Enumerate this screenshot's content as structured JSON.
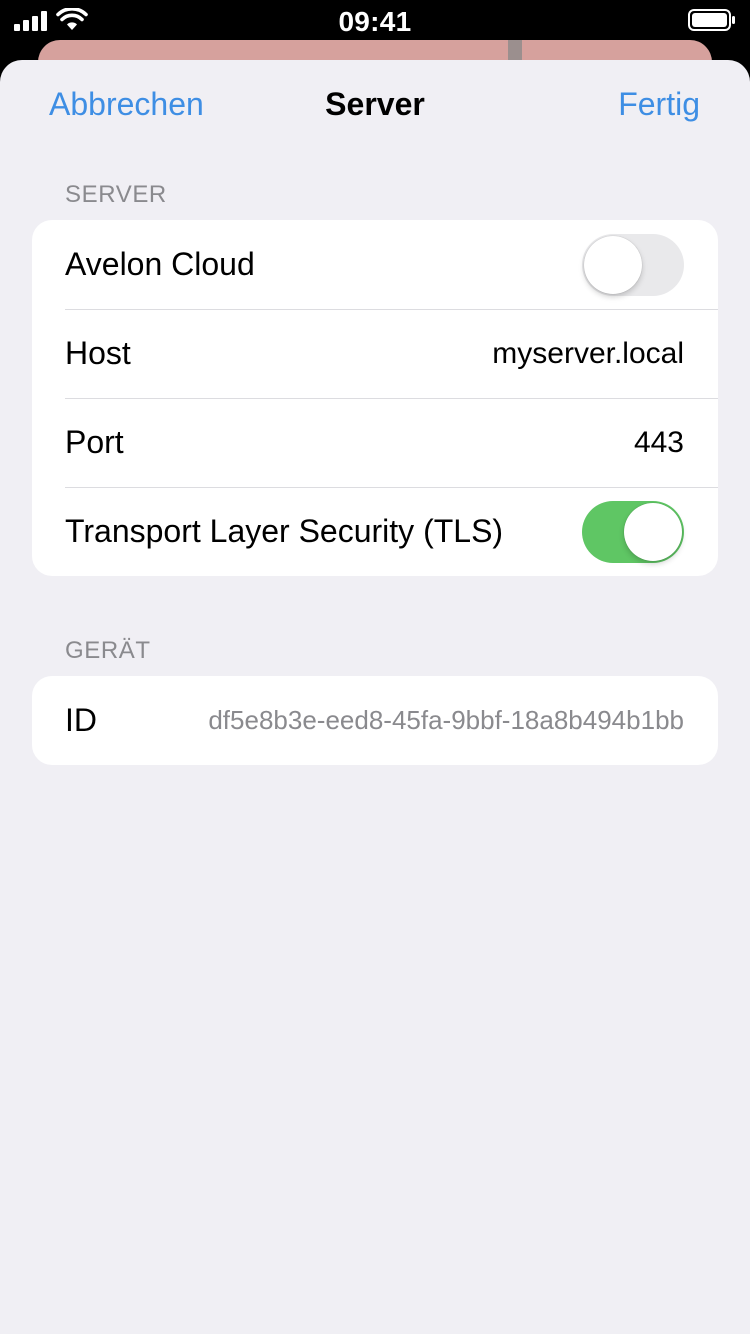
{
  "status_bar": {
    "time": "09:41",
    "icons": [
      "signal-icon",
      "wifi-icon",
      "battery-icon"
    ]
  },
  "nav": {
    "cancel_label": "Abbrechen",
    "title": "Server",
    "done_label": "Fertig"
  },
  "server_section": {
    "header": "SERVER",
    "rows": {
      "cloud": {
        "label": "Avelon Cloud",
        "toggle_on": false
      },
      "host": {
        "label": "Host",
        "value": "myserver.local"
      },
      "port": {
        "label": "Port",
        "value": "443"
      },
      "tls": {
        "label": "Transport Layer Security (TLS)",
        "toggle_on": true
      }
    }
  },
  "device_section": {
    "header": "GERÄT",
    "rows": {
      "id": {
        "label": "ID",
        "value": "df5e8b3e-eed8-45fa-9bbf-18a8b494b1bb"
      }
    }
  },
  "colors": {
    "accent": "#3e8ee4",
    "toggle_on": "#5fc664",
    "toggle_off": "#e9e9eb",
    "background": "#f0eff4",
    "secondary_text": "#8a8a8e"
  }
}
